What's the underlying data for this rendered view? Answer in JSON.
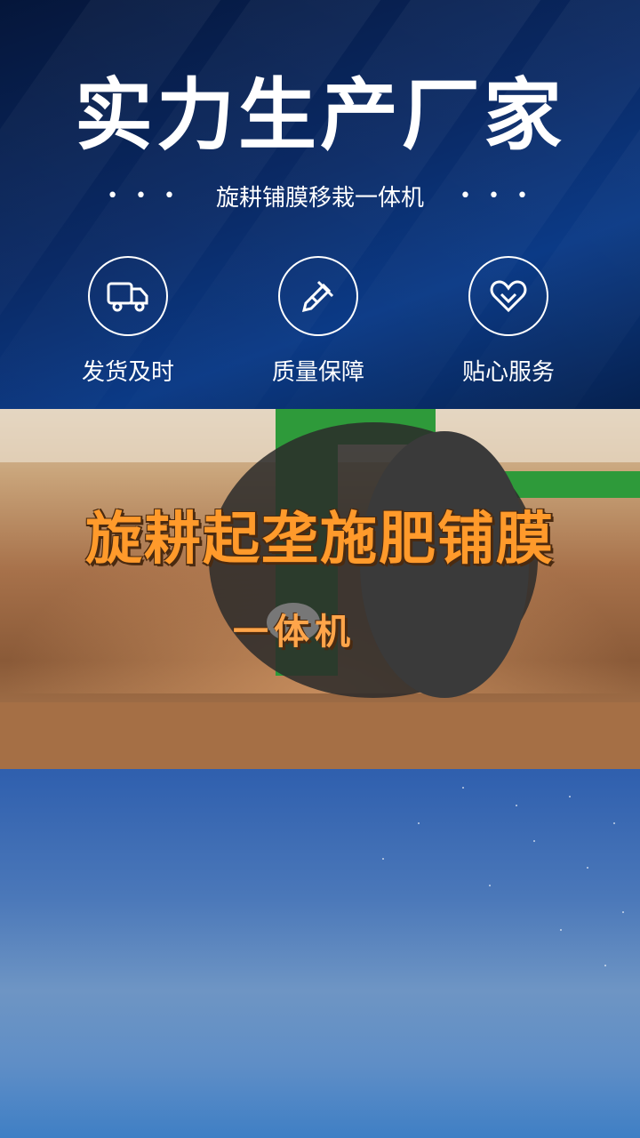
{
  "banner": {
    "title": "实力生产厂家",
    "subtitle": "旋耕铺膜移栽一体机",
    "left_dots": "• • •",
    "right_dots": "• • •",
    "features": [
      {
        "label": "发货及时",
        "icon": "delivery-truck-icon"
      },
      {
        "label": "质量保障",
        "icon": "quality-badge-icon"
      },
      {
        "label": "贴心服务",
        "icon": "heart-service-icon"
      }
    ]
  },
  "photo": {
    "overlay_title": "旋耕起垄施肥铺膜",
    "overlay_subtitle": "一体机"
  }
}
